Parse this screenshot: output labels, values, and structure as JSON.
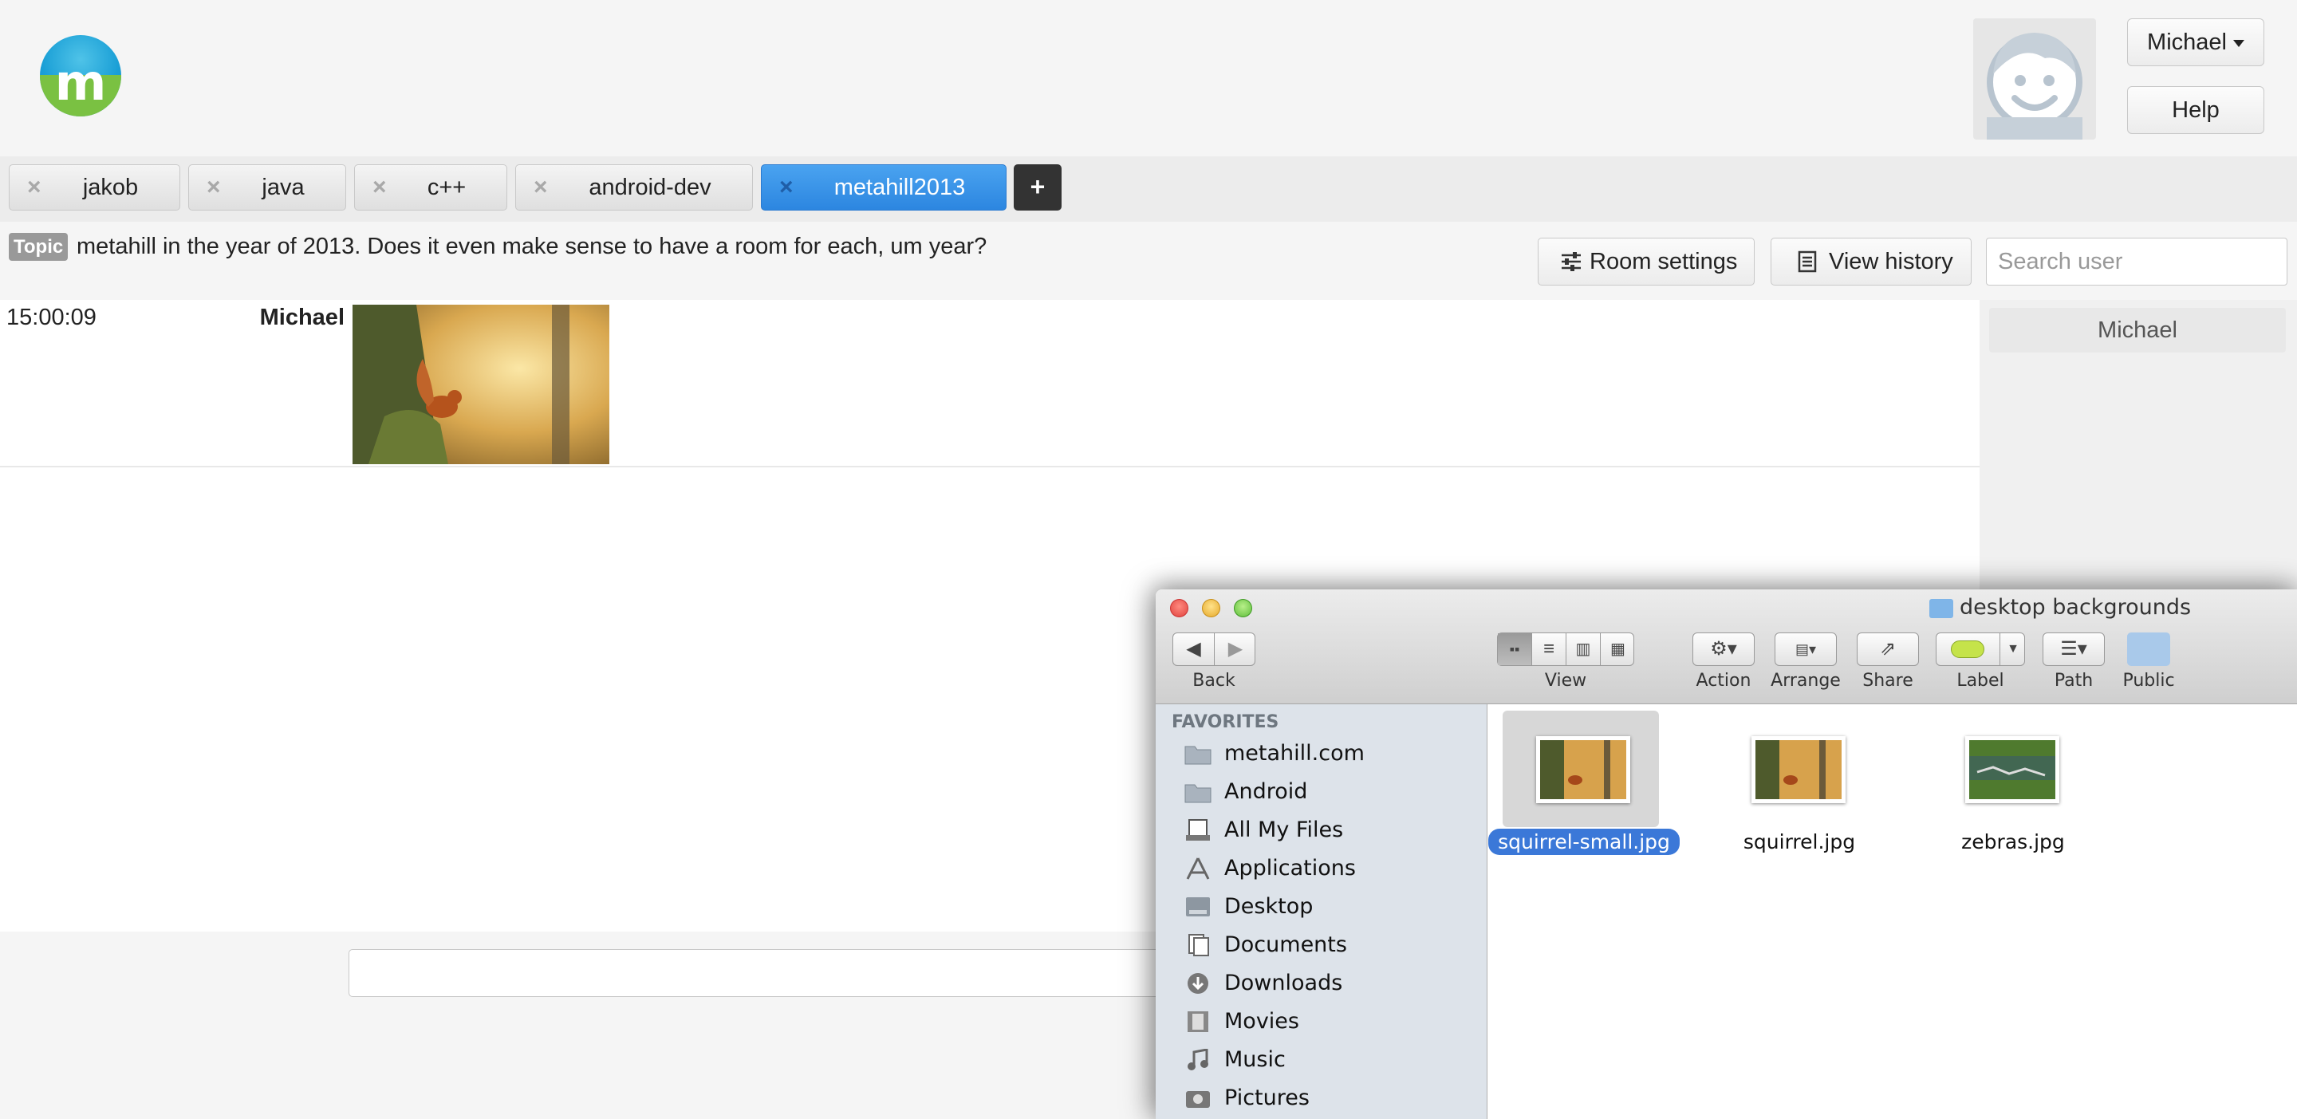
{
  "header": {
    "user_menu_label": "Michael",
    "help_label": "Help"
  },
  "tabs": [
    {
      "label": "jakob",
      "active": false
    },
    {
      "label": "java",
      "active": false
    },
    {
      "label": "c++",
      "active": false
    },
    {
      "label": "android-dev",
      "active": false
    },
    {
      "label": "metahill2013",
      "active": true
    }
  ],
  "tab_add_label": "+",
  "topic": {
    "badge": "Topic",
    "text": "metahill in the year of 2013. Does it even make sense to have a room for each, um year?"
  },
  "toolbar": {
    "room_settings_label": "Room settings",
    "view_history_label": "View history",
    "search_user_placeholder": "Search user"
  },
  "messages": [
    {
      "time": "15:00:09",
      "user": "Michael",
      "content": "image"
    }
  ],
  "online_users": [
    "Michael"
  ],
  "finder": {
    "title": "desktop backgrounds",
    "toolbar_labels": {
      "back": "Back",
      "view": "View",
      "action": "Action",
      "arrange": "Arrange",
      "share": "Share",
      "label": "Label",
      "path": "Path",
      "public": "Public"
    },
    "sidebar_heading": "FAVORITES",
    "sidebar_items": [
      {
        "label": "metahill.com",
        "icon": "folder-icon"
      },
      {
        "label": "Android",
        "icon": "folder-icon"
      },
      {
        "label": "All My Files",
        "icon": "all-files-icon"
      },
      {
        "label": "Applications",
        "icon": "applications-icon"
      },
      {
        "label": "Desktop",
        "icon": "desktop-icon"
      },
      {
        "label": "Documents",
        "icon": "documents-icon"
      },
      {
        "label": "Downloads",
        "icon": "downloads-icon"
      },
      {
        "label": "Movies",
        "icon": "movies-icon"
      },
      {
        "label": "Music",
        "icon": "music-icon"
      },
      {
        "label": "Pictures",
        "icon": "pictures-icon"
      }
    ],
    "files": [
      {
        "name": "squirrel-small.jpg",
        "selected": true
      },
      {
        "name": "squirrel.jpg",
        "selected": false
      },
      {
        "name": "zebras.jpg",
        "selected": false
      }
    ]
  },
  "colors": {
    "active_tab": "#2c86e0",
    "selection": "#3b78d8",
    "logo_blue": "#1a9fd6",
    "logo_green": "#7ac142"
  }
}
